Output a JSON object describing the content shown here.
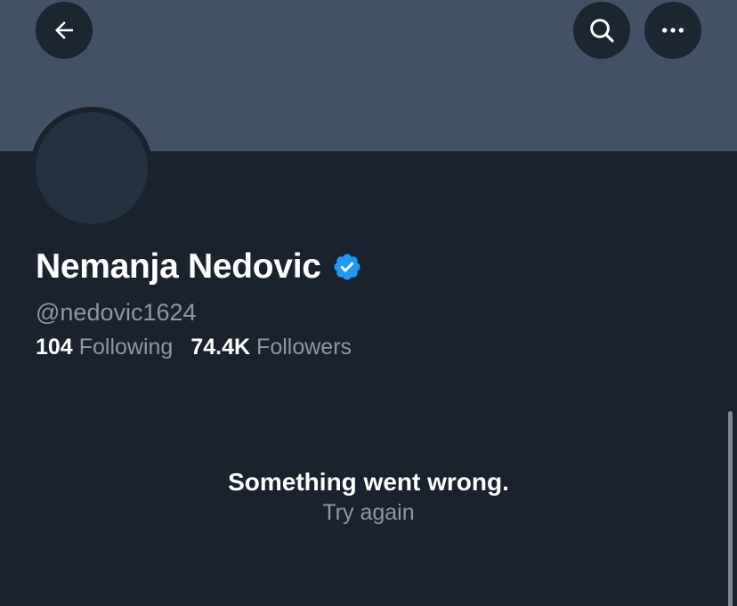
{
  "header": {
    "back_icon": "arrow-left-icon",
    "search_icon": "search-icon",
    "more_icon": "more-horizontal-icon"
  },
  "profile": {
    "display_name": "Nemanja Nedovic",
    "verified_icon": "verified-badge-icon",
    "handle": "@nedovic1624",
    "following_count": "104",
    "following_label": "Following",
    "followers_count": "74.4K",
    "followers_label": "Followers"
  },
  "error": {
    "title": "Something went wrong.",
    "retry_label": "Try again"
  },
  "colors": {
    "banner": "#425165",
    "background": "#1a222d",
    "verified": "#1d9bf0",
    "muted_text": "#8b98a5"
  }
}
